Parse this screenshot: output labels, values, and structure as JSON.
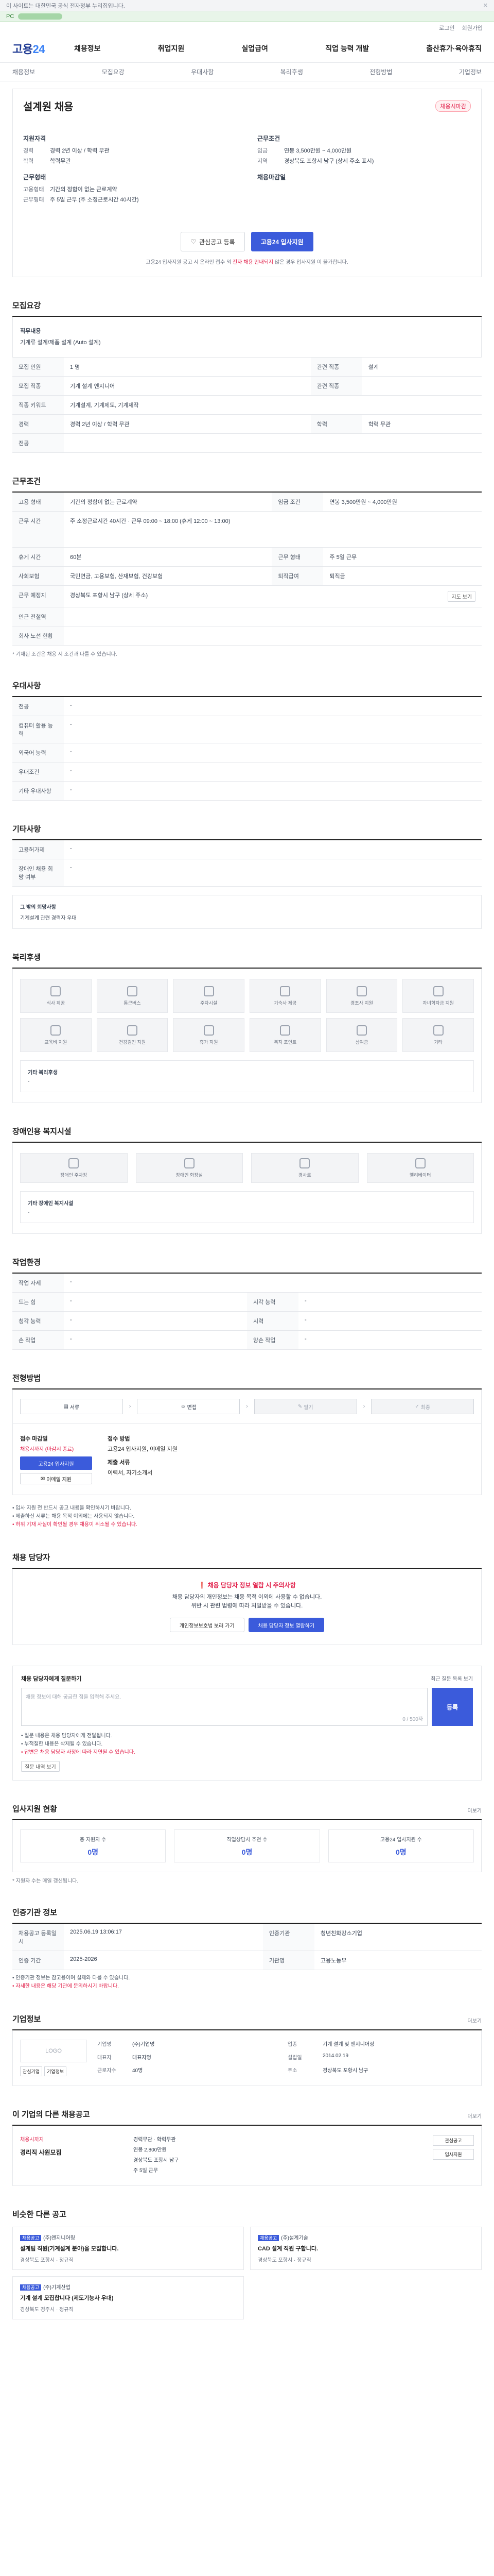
{
  "topbar": {
    "notice": "이 사이트는 대한민국 공식 전자정부 누리집입니다.",
    "close": "✕",
    "green_label": "PC"
  },
  "util": {
    "login": "로그인",
    "signup": "회원가입"
  },
  "header": {
    "logo_main": "고용",
    "logo_sub": "24",
    "gnb": [
      "채용정보",
      "취업지원",
      "실업급여",
      "직업 능력 개발",
      "출산휴가·육아휴직"
    ]
  },
  "subnav": {
    "items": [
      "채용정보",
      "모집요강",
      "우대사항",
      "복리후생",
      "전형방법",
      "기업정보"
    ]
  },
  "job": {
    "title": "설계원 채용",
    "badge": "채용시마감",
    "left_head": "지원자격",
    "left_rows": [
      {
        "k": "경력",
        "v": "경력 2년 이상 / 학력 무관"
      },
      {
        "k": "학력",
        "v": "학력무관"
      }
    ],
    "left_head2": "근무형태",
    "left_rows2": [
      {
        "k": "고용형태",
        "v": "기간의 정함이 없는 근로계약"
      },
      {
        "k": "근무형태",
        "v": "주 5일 근무 (주 소정근로시간 40시간)"
      }
    ],
    "right_head": "근무조건",
    "right_rows": [
      {
        "k": "임금",
        "v": "연봉 3,500만원 ~ 4,000만원"
      },
      {
        "k": "지역",
        "v": "경상북도 포항시 남구 (상세 주소 표시)"
      }
    ],
    "right_head2": "채용마감일",
    "scrap": "관심공고 등록",
    "apply": "고용24 입사지원",
    "note_prefix": "고용24 입사지원 공고 시 온라인 접수 외",
    "note_red": "전자 채용 안내되지",
    "note_suffix": "않은 경우 입사지원 이 불가합니다."
  },
  "desc": {
    "title": "모집요강",
    "head": "직무내용",
    "body": "기계류 설계/제품 설계 (Auto 설계)"
  },
  "recruit": {
    "rows": [
      [
        "모집 인원",
        "1 명",
        "관련 직종",
        "설계"
      ],
      [
        "모집 직종",
        "기계 설계 엔지니어",
        "관련 직종",
        ""
      ],
      [
        "직종 키워드",
        "기계설계, 기계제도, 기계제작",
        "",
        ""
      ],
      [
        "경력",
        "경력 2년 이상 / 학력 무관",
        "학력",
        "학력 무관"
      ],
      [
        "전공",
        "",
        "",
        ""
      ]
    ]
  },
  "conditions": {
    "title": "근무조건",
    "rows": [
      {
        "k": "고용 형태",
        "v": "기간의 정함이 없는 근로계약",
        "k2": "임금 조건",
        "v2": "연봉 3,500만원 ~ 4,000만원"
      },
      {
        "k": "근무 시간",
        "v": "주 소정근로시간 40시간 · 근무 09:00 ~ 18:00 (휴게 12:00 ~ 13:00)",
        "k2": "",
        "v2": ""
      },
      {
        "k": "휴게 시간",
        "v": "60분",
        "k2": "근무 형태",
        "v2": "주 5일 근무"
      },
      {
        "k": "사회보험",
        "v": "국민연금, 고용보험, 산재보험, 건강보험",
        "k2": "퇴직급여",
        "v2": "퇴직금"
      },
      {
        "k": "근무 예정지",
        "v": "경상북도 포항시 남구 (상세 주소)",
        "k2": "",
        "v2": ""
      },
      {
        "k": "인근 전철역",
        "v": "",
        "k2": "",
        "v2": ""
      },
      {
        "k": "회사 노선 현황",
        "v": "",
        "k2": "",
        "v2": ""
      }
    ],
    "map_btn": "지도 보기",
    "footnote": "* 기재된 조건은 채용 시 조건과 다를 수 있습니다."
  },
  "preference": {
    "title": "우대사항",
    "rows": [
      [
        "전공",
        "-"
      ],
      [
        "컴퓨터 활용 능력",
        "-"
      ],
      [
        "외국어 능력",
        "-"
      ],
      [
        "우대조건",
        "-"
      ],
      [
        "기타 우대사항",
        "-"
      ]
    ]
  },
  "etc": {
    "title": "기타사항",
    "rows": [
      [
        "고용허가제",
        "-"
      ],
      [
        "장애인 채용 희망 여부",
        "-"
      ]
    ],
    "box_head": "그 밖의 희망사항",
    "box_body": "기계설계 관련 경력자 우대"
  },
  "welfare": {
    "title": "복리후생",
    "tiles": [
      "식사 제공",
      "통근버스",
      "주차시설",
      "기숙사 제공",
      "경조사 지원",
      "자녀학자금 지원",
      "교육비 지원",
      "건강검진 지원",
      "휴가 지원",
      "복지 포인트",
      "상여금",
      "기타"
    ],
    "sub_head": "기타 복리후생",
    "sub_body": "-"
  },
  "disabled": {
    "title": "장애인용 복지시설",
    "tiles": [
      "장애인 주차장",
      "장애인 화장실",
      "경사로",
      "엘리베이터"
    ],
    "sub_head": "기타 장애인 복지시설",
    "sub_body": "-"
  },
  "work_env": {
    "title": "작업환경",
    "rows": [
      [
        "작업 자세",
        "-",
        "",
        ""
      ],
      [
        "드는 힘",
        "-",
        "시각 능력",
        "-"
      ],
      [
        "청각 능력",
        "-",
        "시력",
        "-"
      ],
      [
        "손 작업",
        "-",
        "양손 작업",
        "-"
      ]
    ]
  },
  "procedure": {
    "title": "전형방법",
    "steps": [
      "서류",
      "면접",
      "필기",
      "최종"
    ],
    "apply_head": "접수 마감일",
    "apply_red": "채용시까지 (마감시 종료)",
    "apply_btn": "고용24 입사지원",
    "apply_btn2": "이메일 지원",
    "docs_head": "접수 방법",
    "docs_body": "고용24 입사지원, 이메일 지원",
    "docs_head2": "제출 서류",
    "docs_body2": "이력서, 자기소개서",
    "bullets": [
      "입사 지원 전 반드시 공고 내용을 확인하시기 바랍니다.",
      "제출하신 서류는 채용 목적 이외에는 사용되지 않습니다.",
      "허위 기재 사실이 확인될 경우 채용이 취소될 수 있습니다."
    ]
  },
  "manager": {
    "title": "채용 담당자",
    "warn_title": "채용 담당자 정보 열람 시 주의사항",
    "warn_body1": "채용 담당자의 개인정보는 채용 목적 이외에 사용할 수 없습니다.",
    "warn_body2": "위반 시 관련 법령에 따라 처벌받을 수 있습니다.",
    "btn1": "개인정보보호법 보러 가기",
    "btn2": "채용 담당자 정보 열람하기"
  },
  "qna": {
    "head": "채용 담당자에게 질문하기",
    "sub": "최근 질문 목록 보기",
    "placeholder": "채용 정보에 대해 궁금한 점을 입력해 주세요.",
    "count": "0 / 500자",
    "submit": "등록",
    "notes": [
      "질문 내용은 채용 담당자에게 전달됩니다.",
      "부적절한 내용은 삭제될 수 있습니다.",
      "답변은 채용 담당자 사정에 따라 지연될 수 있습니다."
    ],
    "notes_btn": "질문 내역 보기"
  },
  "applicants": {
    "title": "입사지원 현황",
    "more": "더보기",
    "stats": [
      {
        "label": "총 지원자 수",
        "n": "0명"
      },
      {
        "label": "직업상담사 추천 수",
        "n": "0명"
      },
      {
        "label": "고용24 입사지원 수",
        "n": "0명"
      }
    ],
    "note": "* 지원자 수는 매일 갱신됩니다."
  },
  "cert": {
    "title": "인증기관 정보",
    "rows": [
      [
        "채용공고 등록일시",
        "2025.06.19 13:06:17",
        "인증기관",
        "청년친화강소기업"
      ],
      [
        "인증 기간",
        "2025-2026",
        "기관명",
        "고용노동부"
      ]
    ],
    "notes": [
      "인증기관 정보는 참고용이며 실제와 다를 수 있습니다.",
      "자세한 내용은 해당 기관에 문의하시기 바랍니다."
    ]
  },
  "company": {
    "title": "기업정보",
    "more": "더보기",
    "logo": "LOGO",
    "btns": [
      "관심기업",
      "기업정보"
    ],
    "info": [
      [
        "기업명",
        "(주)기업명",
        "업종",
        "기계 설계 및 엔지니어링"
      ],
      [
        "대표자",
        "대표자명",
        "설립일",
        "2014.02.19"
      ],
      [
        "근로자수",
        "40명",
        "주소",
        "경상북도 포항시 남구"
      ]
    ]
  },
  "other_jobs": {
    "title": "이 기업의 다른 채용공고",
    "more": "더보기",
    "red": "채용시까지",
    "job_title": "경리직 사원모집",
    "meta": [
      "경력무관 · 학력무관",
      "연봉 2,800만원",
      "경상북도 포항시 남구",
      "주 5일 근무"
    ],
    "btns": [
      "관심공고",
      "입사지원"
    ]
  },
  "recommend": {
    "title": "비슷한 다른 공고",
    "cards": [
      {
        "tag": "채용공고",
        "co": "(주)엔지니어링",
        "t": "설계팀 직원(기계설계 분야)을 모집합니다.",
        "m": "경상북도 포항시 · 정규직"
      },
      {
        "tag": "채용공고",
        "co": "(주)설계기술",
        "t": "CAD 설계 직원 구합니다.",
        "m": "경상북도 포항시 · 정규직"
      },
      {
        "tag": "채용공고",
        "co": "(주)기계산업",
        "t": "기계 설계 모집합니다 (제도기능사 우대)",
        "m": "경상북도 경주시 · 정규직"
      }
    ]
  }
}
